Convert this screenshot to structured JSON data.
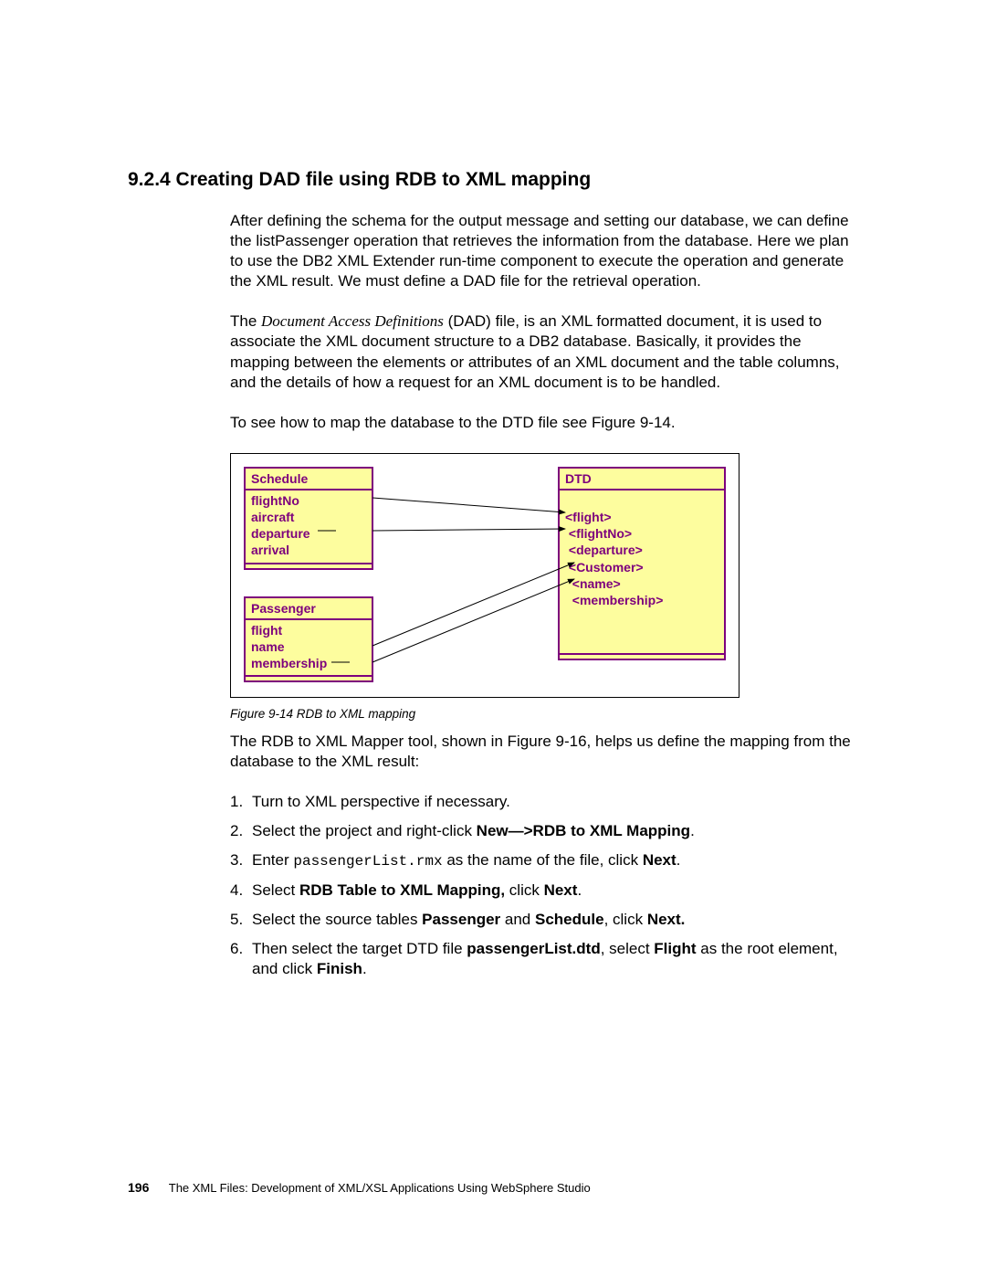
{
  "heading": "9.2.4  Creating DAD file using RDB to XML mapping",
  "para1": "After defining the schema for the output message and setting our database, we can define the listPassenger operation that retrieves the information from the database. Here we plan to use the DB2 XML Extender run-time component to execute the operation and generate the XML result. We must define a DAD file for the retrieval operation.",
  "para2_pre": "The ",
  "para2_italic": "Document Access Definitions",
  "para2_post": " (DAD) file, is an XML formatted document, it is used to associate the XML document structure to a DB2 database. Basically, it provides the mapping between the elements or attributes of an XML document and the table columns, and the details of how a request for an XML document is to be handled.",
  "para3": "To see how to map the database to the DTD file see Figure 9-14.",
  "figure": {
    "schedule": {
      "title": "Schedule",
      "rows": [
        "flightNo",
        "aircraft",
        "departure",
        "arrival"
      ]
    },
    "passenger": {
      "title": "Passenger",
      "rows": [
        "flight",
        "name",
        "membership"
      ]
    },
    "dtd": {
      "title": "DTD",
      "rows": [
        "<flight>",
        " <flightNo>",
        " <departure>",
        " <Customer>",
        "  <name>",
        "  <membership>"
      ]
    },
    "caption": "Figure 9-14   RDB to XML mapping"
  },
  "para4": "The RDB to XML Mapper tool, shown in Figure 9-16, helps us define the mapping from the database to the XML result:",
  "steps": {
    "s1": "Turn to XML perspective if necessary.",
    "s2a": "Select the project and right-click ",
    "s2b": "New—>RDB to XML Mapping",
    "s2c": ".",
    "s3a": "Enter ",
    "s3b": "passengerList.rmx",
    "s3c": " as the name of the file, click ",
    "s3d": "Next",
    "s3e": ".",
    "s4a": "Select ",
    "s4b": "RDB Table to XML Mapping, ",
    "s4c": "click ",
    "s4d": "Next",
    "s4e": ".",
    "s5a": "Select the source tables ",
    "s5b": "Passenger",
    "s5c": " and ",
    "s5d": "Schedule",
    "s5e": ", click ",
    "s5f": "Next.",
    "s6a": "Then select the target DTD file ",
    "s6b": "passengerList.dtd",
    "s6c": ", select ",
    "s6d": "Flight",
    "s6e": " as the root element, and click ",
    "s6f": "Finish",
    "s6g": "."
  },
  "footer": {
    "pageno": "196",
    "title": "The XML Files:  Development of XML/XSL Applications Using WebSphere Studio"
  }
}
